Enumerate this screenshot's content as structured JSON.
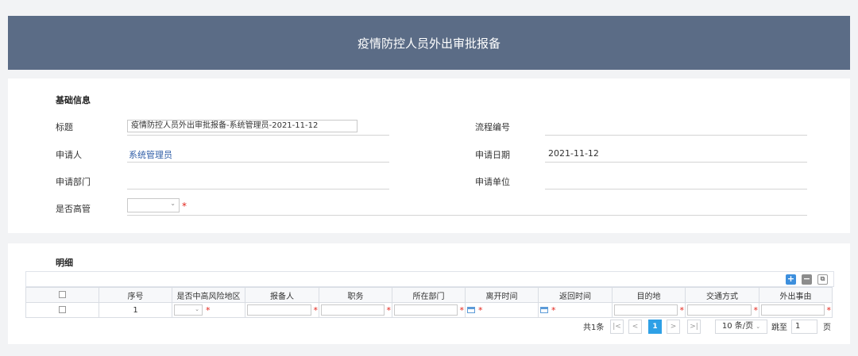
{
  "header": {
    "title": "疫情防控人员外出审批报备"
  },
  "basic": {
    "section_title": "基础信息",
    "title_label": "标题",
    "title_value": "疫情防控人员外出审批报备-系统管理员-2021-11-12",
    "process_no_label": "流程编号",
    "process_no_value": "",
    "applicant_label": "申请人",
    "applicant_value": "系统管理员",
    "apply_date_label": "申请日期",
    "apply_date_value": "2021-11-12",
    "dept_label": "申请部门",
    "unit_label": "申请单位",
    "senior_label": "是否高管",
    "senior_value": "",
    "required_mark": "*"
  },
  "detail": {
    "section_title": "明细",
    "toolbar": {
      "add": "+",
      "remove": "−",
      "copy": "⧉"
    },
    "columns": [
      "",
      "序号",
      "是否中高风险地区",
      "报备人",
      "职务",
      "所在部门",
      "离开时间",
      "返回时间",
      "目的地",
      "交通方式",
      "外出事由"
    ],
    "rows": [
      {
        "index": "1"
      }
    ],
    "pager": {
      "total": "共1条",
      "first": "|<",
      "prev": "<",
      "current": "1",
      "next": ">",
      "last": ">|",
      "page_size": "10 条/页",
      "jump_label": "跳至",
      "jump_value": "1",
      "page_unit": "页"
    }
  }
}
